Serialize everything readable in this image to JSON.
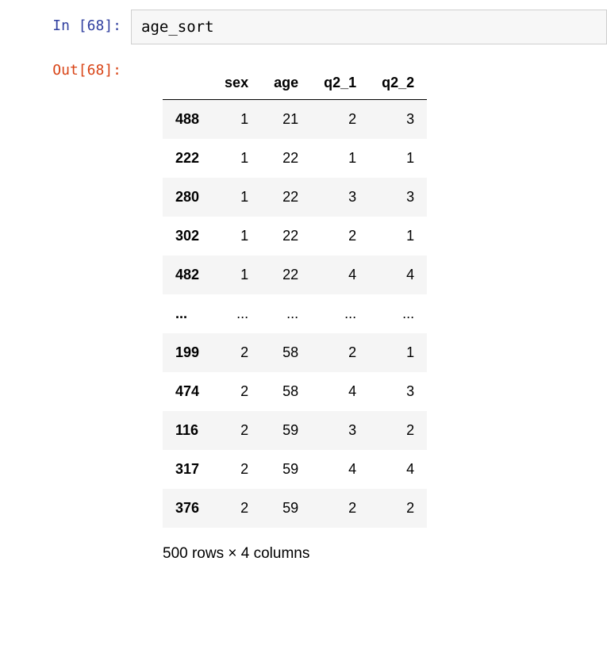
{
  "input_prompt": "In [68]:",
  "output_prompt": "Out[68]:",
  "code": "age_sort",
  "dataframe": {
    "columns": [
      "sex",
      "age",
      "q2_1",
      "q2_2"
    ],
    "rows": [
      {
        "index": "488",
        "values": [
          "1",
          "21",
          "2",
          "3"
        ]
      },
      {
        "index": "222",
        "values": [
          "1",
          "22",
          "1",
          "1"
        ]
      },
      {
        "index": "280",
        "values": [
          "1",
          "22",
          "3",
          "3"
        ]
      },
      {
        "index": "302",
        "values": [
          "1",
          "22",
          "2",
          "1"
        ]
      },
      {
        "index": "482",
        "values": [
          "1",
          "22",
          "4",
          "4"
        ]
      },
      {
        "index": "...",
        "values": [
          "...",
          "...",
          "...",
          "..."
        ]
      },
      {
        "index": "199",
        "values": [
          "2",
          "58",
          "2",
          "1"
        ]
      },
      {
        "index": "474",
        "values": [
          "2",
          "58",
          "4",
          "3"
        ]
      },
      {
        "index": "116",
        "values": [
          "2",
          "59",
          "3",
          "2"
        ]
      },
      {
        "index": "317",
        "values": [
          "2",
          "59",
          "4",
          "4"
        ]
      },
      {
        "index": "376",
        "values": [
          "2",
          "59",
          "2",
          "2"
        ]
      }
    ],
    "shape_text": "500 rows × 4 columns"
  }
}
